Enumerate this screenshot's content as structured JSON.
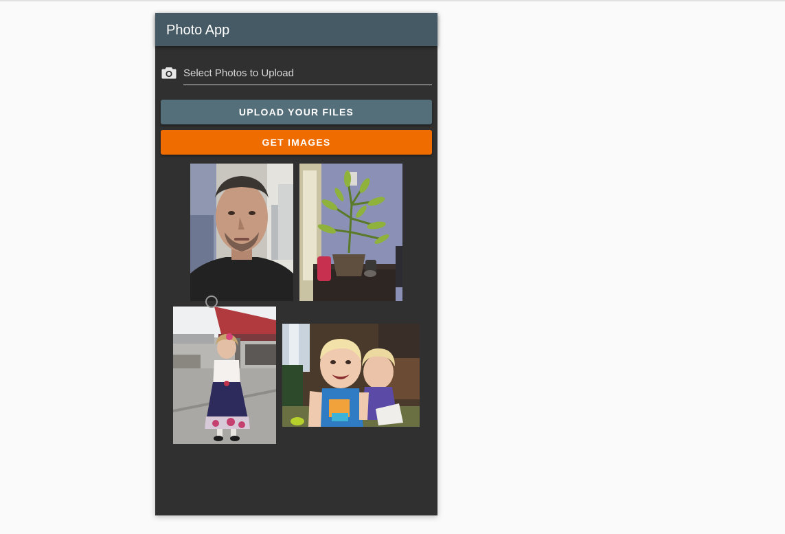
{
  "app": {
    "title": "Photo App"
  },
  "upload": {
    "icon": "camera-icon",
    "placeholder": "Select Photos to Upload"
  },
  "buttons": {
    "upload_label": "UPLOAD YOUR FILES",
    "get_images_label": "GET IMAGES"
  },
  "colors": {
    "toolbar": "#455a64",
    "upload_button": "#546e7a",
    "get_images_button": "#ef6c00",
    "panel_background": "#303030"
  },
  "gallery": {
    "photos": [
      {
        "subject": "man-selfie"
      },
      {
        "subject": "potted-plant"
      },
      {
        "subject": "girl-in-dress"
      },
      {
        "subject": "two-children"
      }
    ]
  }
}
